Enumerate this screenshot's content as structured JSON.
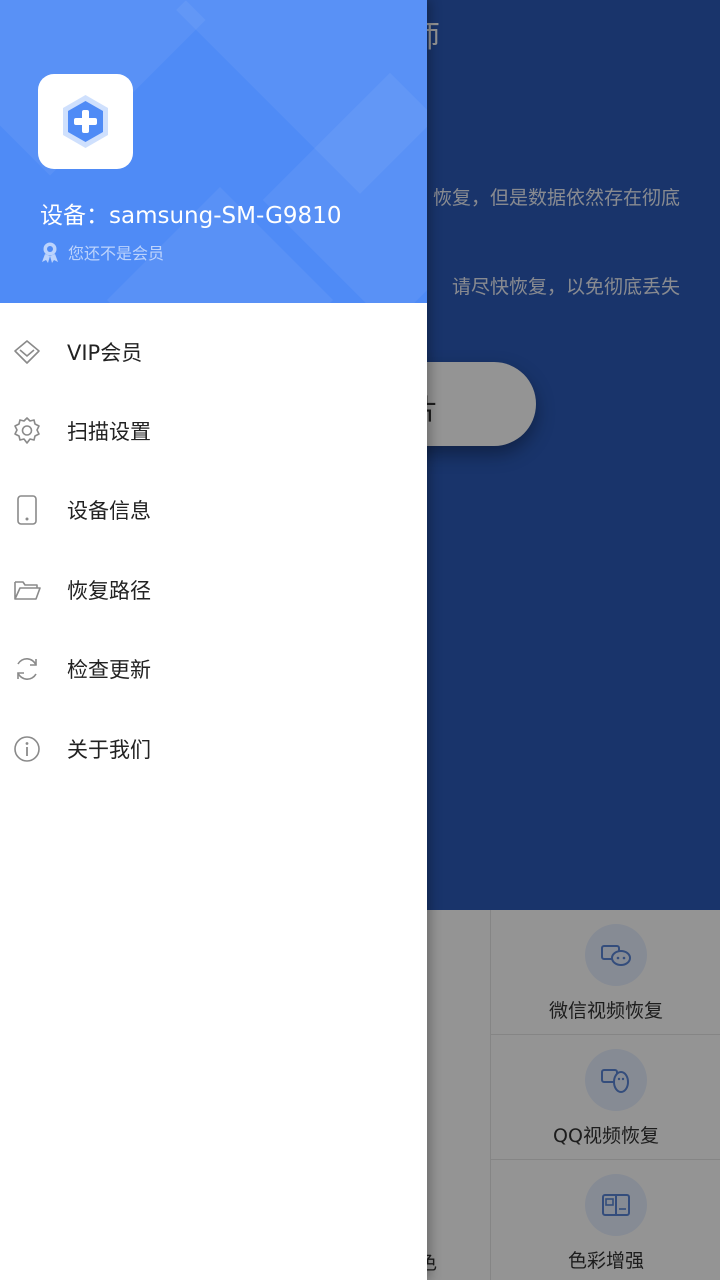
{
  "background": {
    "title_partial": "大师",
    "line1_partial": "恢复，但是数据依然存在彻底",
    "line2_partial": "请尽快恢复，以免彻底丢失",
    "cta_partial": "片",
    "grid": [
      {
        "label": "微信视频恢复",
        "icon": "wechat-video-icon"
      },
      {
        "label": "QQ视频恢复",
        "icon": "qq-video-icon"
      },
      {
        "label": "色彩增强",
        "icon": "photo-enhance-icon"
      }
    ],
    "partial_label": "色"
  },
  "drawer": {
    "header": {
      "device_label": "设备：samsung-SM-G9810",
      "member_status": "您还不是会员"
    },
    "menu": [
      {
        "label": "VIP会员",
        "icon": "diamond-icon"
      },
      {
        "label": "扫描设置",
        "icon": "gear-icon"
      },
      {
        "label": "设备信息",
        "icon": "phone-icon"
      },
      {
        "label": "恢复路径",
        "icon": "folder-icon"
      },
      {
        "label": "检查更新",
        "icon": "refresh-icon"
      },
      {
        "label": "关于我们",
        "icon": "info-icon"
      }
    ]
  },
  "colors": {
    "header_blue": "#4f8bf6",
    "hero_blue": "#2b5ab8",
    "icon_gray": "#8a8a8a"
  }
}
